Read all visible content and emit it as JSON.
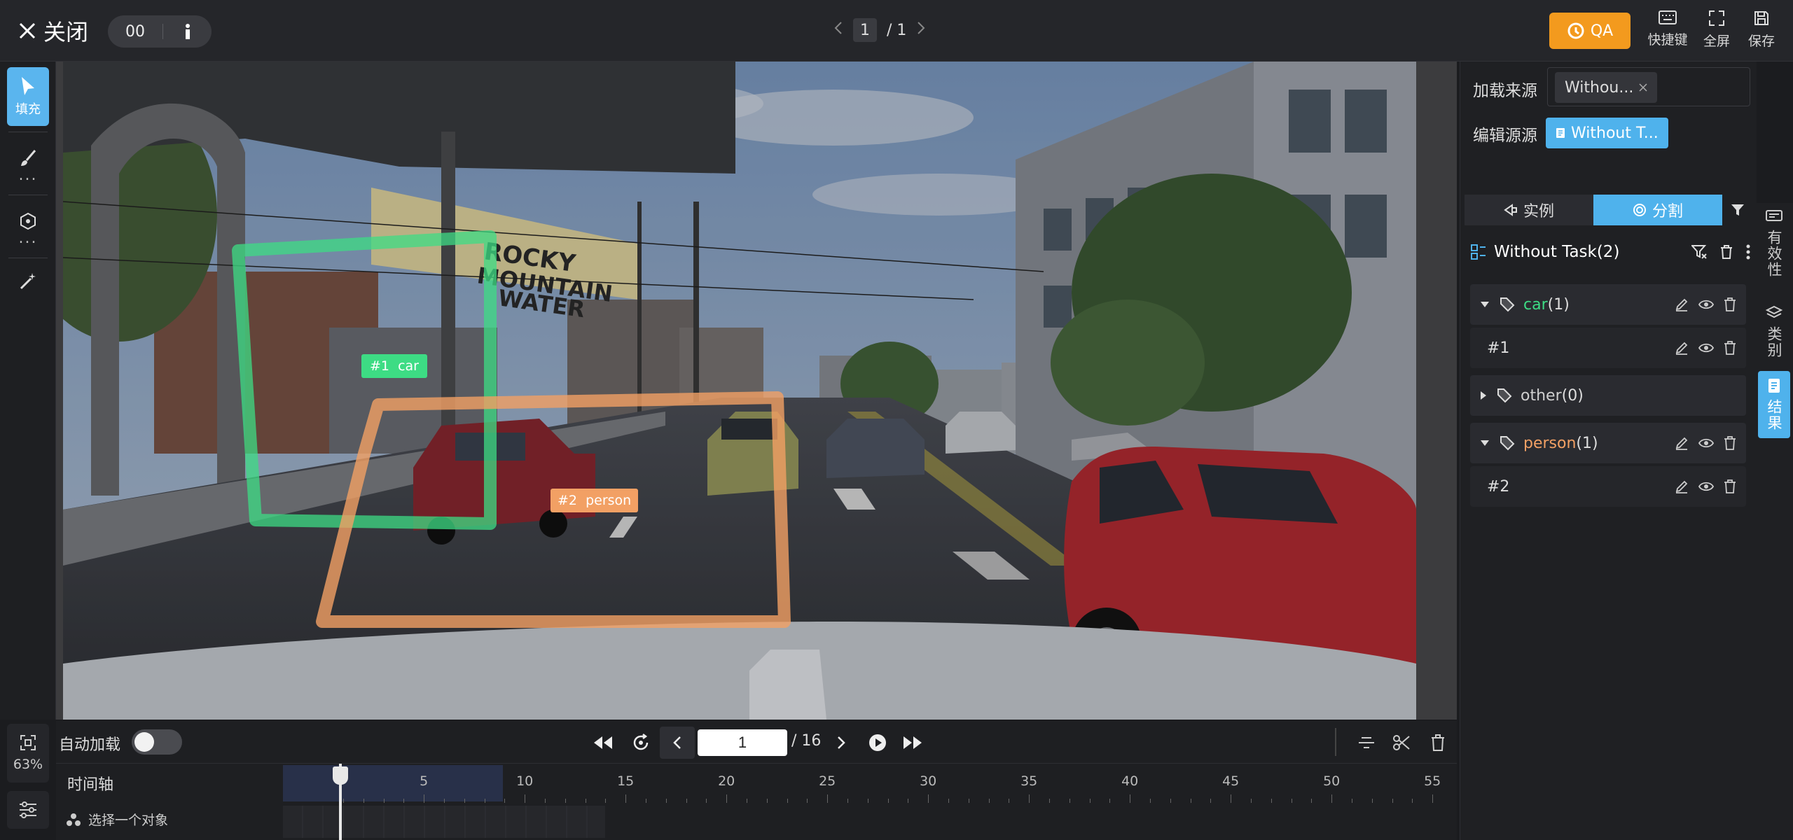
{
  "topbar": {
    "close_label": "关闭",
    "counter": "00",
    "page_current": "1",
    "page_total": "/ 1",
    "qa_label": "QA",
    "shortcuts_label": "快捷键",
    "fullscreen_label": "全屏",
    "save_label": "保存"
  },
  "tools": {
    "select_fill_label": "填充",
    "zoom_percent": "63%"
  },
  "annotations": [
    {
      "id": "#1",
      "category": "car",
      "label": "#1  car",
      "color": "#3ddc84"
    },
    {
      "id": "#2",
      "category": "person",
      "label": "#2  person",
      "color": "#f2a064"
    }
  ],
  "controls": {
    "auto_load_label": "自动加载",
    "frame_current": "1",
    "frame_total": "/ 16"
  },
  "timeline": {
    "label": "时间轴",
    "ticks": [
      "5",
      "10",
      "15",
      "20",
      "25",
      "30",
      "35",
      "40",
      "45",
      "50",
      "55"
    ],
    "select_object_label": "选择一个对象"
  },
  "rightpanel": {
    "load_source_label": "加载来源",
    "load_source_value": "Withou...",
    "edit_source_label": "编辑源源",
    "edit_source_value": "Without T...",
    "tab_instance": "实例",
    "tab_segment": "分割",
    "task_title": "Without Task(2)",
    "groups": [
      {
        "name": "car",
        "count": "(1)",
        "color": "#3ddc84",
        "items": [
          "#1"
        ]
      },
      {
        "name": "other",
        "count": "(0)",
        "color": "#cfcfcf",
        "items": []
      },
      {
        "name": "person",
        "count": "(1)",
        "color": "#f2a064",
        "items": [
          "#2"
        ]
      }
    ]
  },
  "rail": {
    "validity": "有效性",
    "category": "类别",
    "result": "结果"
  },
  "colors": {
    "accent": "#4fb2ec",
    "qa": "#f39a1e",
    "car": "#3ddc84",
    "person": "#f2a064"
  }
}
